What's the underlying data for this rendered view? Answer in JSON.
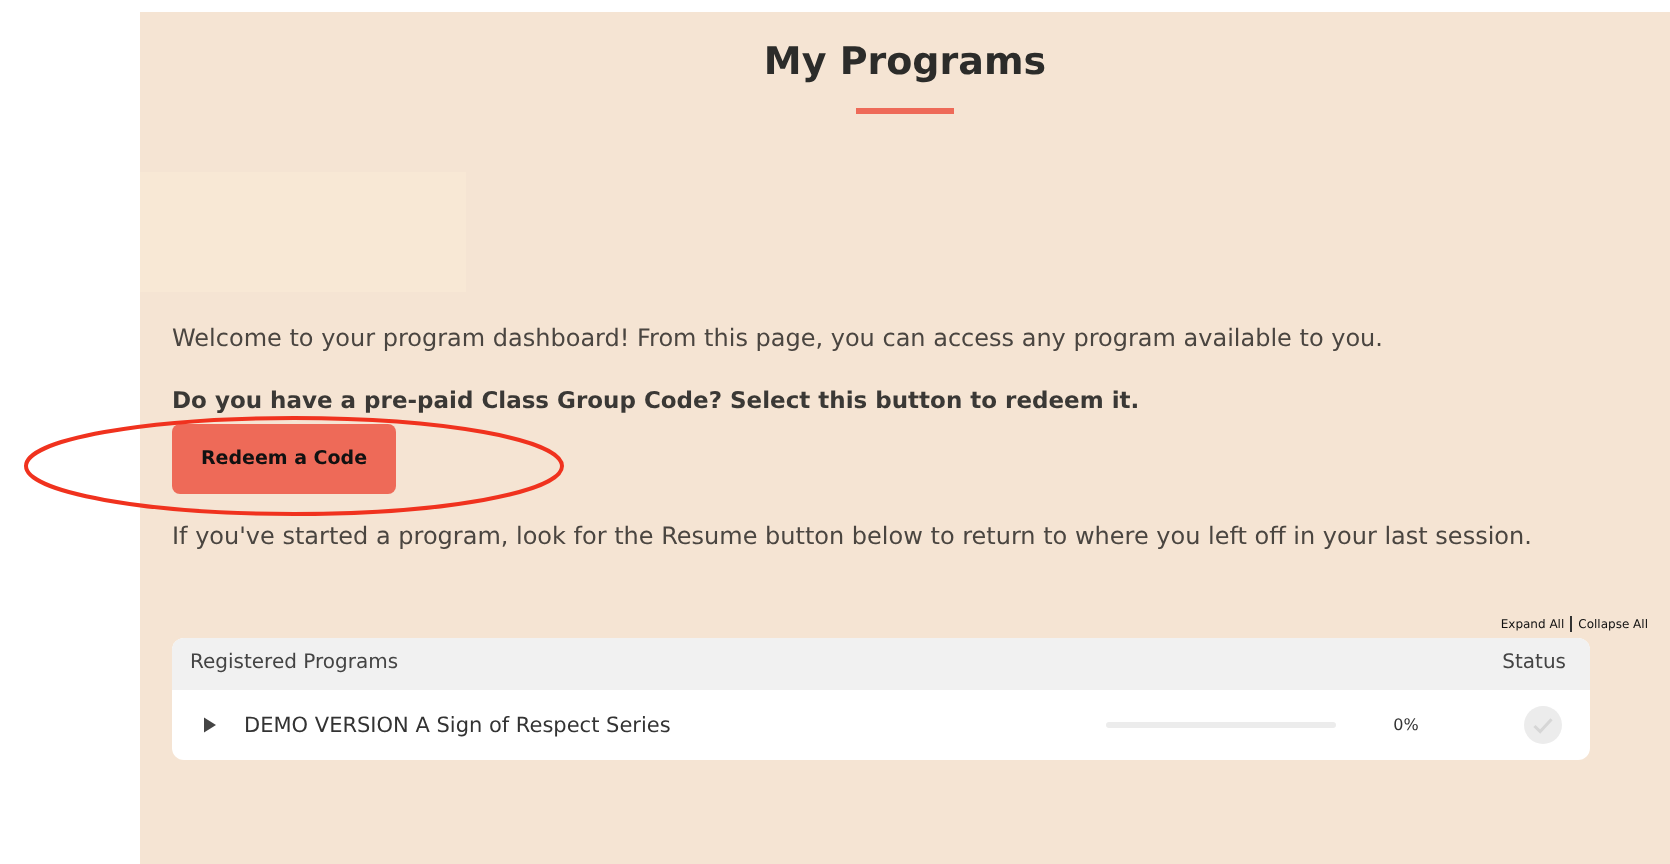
{
  "title": "My Programs",
  "intro": "Welcome to your program dashboard!  From this page, you can access any program available to you.",
  "code_prompt": "Do you have a pre-paid Class Group Code? Select this button to redeem it.",
  "redeem_button": "Redeem a Code",
  "resume_hint": "If you've started a program, look for the Resume button below to return to where you left off in your last session.",
  "toggles": [
    "Expand All",
    "Collapse All"
  ],
  "table": {
    "columns": [
      "Registered Programs",
      "Status"
    ],
    "rows": [
      {
        "name": "DEMO VERSION A Sign of Respect Series",
        "expanded": false,
        "level": 0,
        "percent": "0%",
        "completed": false
      }
    ]
  }
}
